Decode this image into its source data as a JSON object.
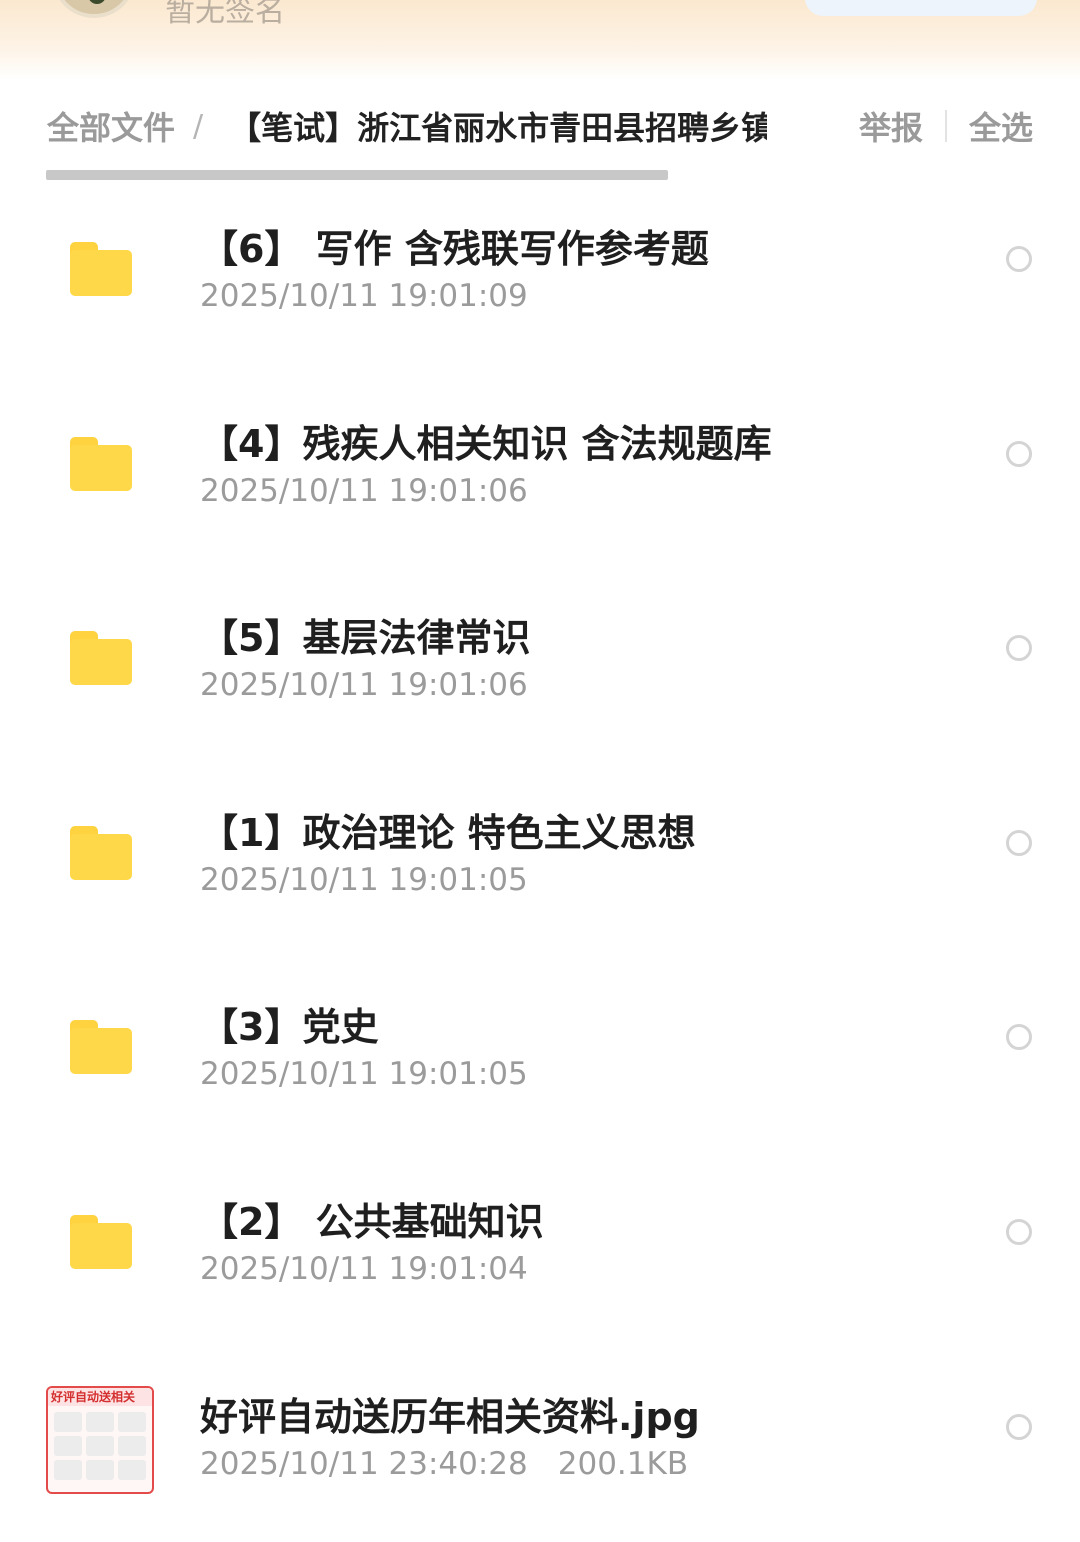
{
  "header": {
    "signature": "暂无签名"
  },
  "breadcrumb": {
    "root": "全部文件",
    "separator": "/",
    "current": "【笔试】浙江省丽水市青田县招聘乡镇"
  },
  "actions": {
    "report": "举报",
    "select_all": "全选"
  },
  "files": [
    {
      "type": "folder",
      "name": "【6】 写作 含残联写作参考题",
      "date": "2025/10/11 19:01:09"
    },
    {
      "type": "folder",
      "name": "【4】残疾人相关知识 含法规题库",
      "date": "2025/10/11 19:01:06"
    },
    {
      "type": "folder",
      "name": "【5】基层法律常识",
      "date": "2025/10/11 19:01:06"
    },
    {
      "type": "folder",
      "name": "【1】政治理论 特色主义思想",
      "date": "2025/10/11 19:01:05"
    },
    {
      "type": "folder",
      "name": "【3】党史",
      "date": "2025/10/11 19:01:05"
    },
    {
      "type": "folder",
      "name": "【2】 公共基础知识",
      "date": "2025/10/11 19:01:04"
    },
    {
      "type": "image",
      "name": "好评自动送历年相关资料.jpg",
      "date": "2025/10/11 23:40:28",
      "size": "200.1KB",
      "thumb_label": "好评自动送相关"
    }
  ],
  "colors": {
    "folder": "#ffd84a",
    "accent_border": "#e34b4b",
    "muted_text": "#9b9b9b"
  }
}
